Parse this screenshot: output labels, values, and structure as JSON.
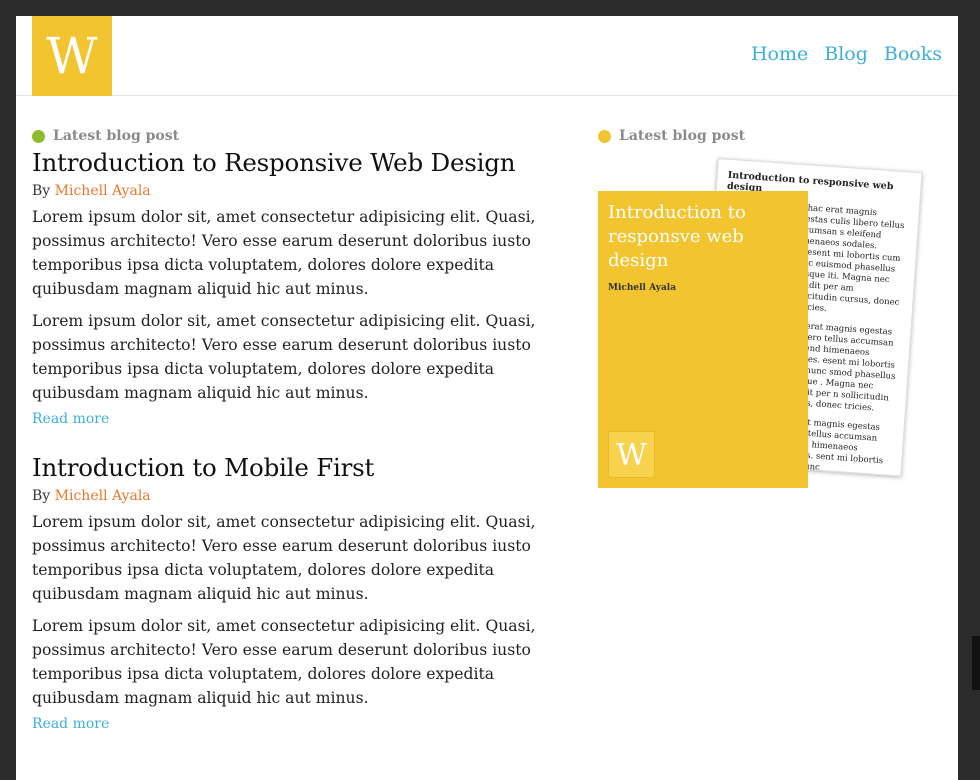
{
  "header": {
    "logo_letter": "W",
    "nav": [
      "Home",
      "Blog",
      "Books"
    ]
  },
  "colors": {
    "accent_yellow": "#f2c430",
    "link_blue": "#3bb0d9",
    "author_orange": "#e8772e",
    "kicker_green": "#8dbb2e"
  },
  "main": {
    "kicker": "Latest blog post",
    "posts": [
      {
        "title": "Introduction to Responsive Web Design",
        "by": "By",
        "author": "Michell Ayala",
        "paragraphs": [
          "Lorem ipsum dolor sit, amet consectetur adipisicing elit. Quasi, possimus architecto! Vero esse earum deserunt doloribus iusto temporibus ipsa dicta voluptatem, dolores dolore expedita quibusdam magnam aliquid hic aut minus.",
          "Lorem ipsum dolor sit, amet consectetur adipisicing elit. Quasi, possimus architecto! Vero esse earum deserunt doloribus iusto temporibus ipsa dicta voluptatem, dolores dolore expedita quibusdam magnam aliquid hic aut minus."
        ],
        "read_more": "Read more"
      },
      {
        "title": "Introduction to Mobile First",
        "by": "By",
        "author": "Michell Ayala",
        "paragraphs": [
          "Lorem ipsum dolor sit, amet consectetur adipisicing elit. Quasi, possimus architecto! Vero esse earum deserunt doloribus iusto temporibus ipsa dicta voluptatem, dolores dolore expedita quibusdam magnam aliquid hic aut minus.",
          "Lorem ipsum dolor sit, amet consectetur adipisicing elit. Quasi, possimus architecto! Vero esse earum deserunt doloribus iusto temporibus ipsa dicta voluptatem, dolores dolore expedita quibusdam magnam aliquid hic aut minus."
        ],
        "read_more": "Read more"
      }
    ]
  },
  "aside": {
    "kicker": "Latest blog post",
    "book": {
      "cover_title": "Introduction to responsve web design",
      "cover_author": "Michell Ayala",
      "cover_logo": "W",
      "page_title": "Introduction to responsive web design",
      "page_text_1": "or hac erat magnis egestas culis libero tellus accumsan s eleifend himenaeos sodales. praesent mi lobortis cum nunc euismod phasellus quisque iti. Magna nec blandit per am sollicitudin cursus, donec ultricies.",
      "page_text_2": "hac erat magnis egestas is libero tellus accumsan eleifend himenaeos sodales. esent mi lobortis cum nunc smod phasellus quisque . Magna nec blandit per n sollicitudin cursus, donec tricies.",
      "page_text_3": "ac erat magnis egestas libero tellus accumsan elifend himenaeos sodales. sent mi lobortis cum nunc"
    }
  }
}
